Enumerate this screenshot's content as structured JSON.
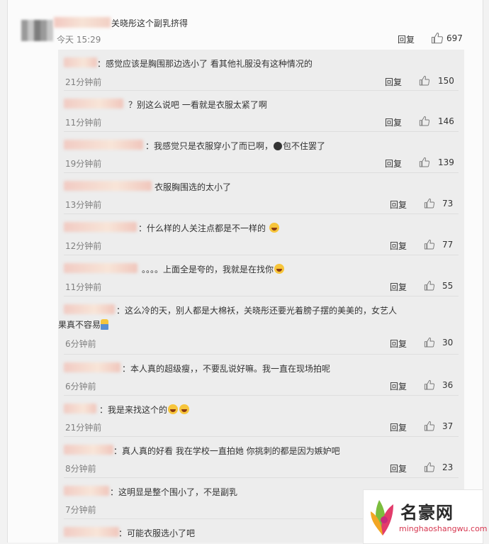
{
  "main_comment": {
    "text": "关晓彤这个副乳挤得",
    "time": "今天 15:29",
    "reply_label": "回复",
    "likes": "697"
  },
  "replies": [
    {
      "text": "：感觉应该是胸围那边选小了  看其他礼服没有这种情况的",
      "time": "21分钟前",
      "reply_label": "回复",
      "likes": "150"
    },
    {
      "text": "？别这么说吧 一看就是衣服太紧了啊",
      "time": "11分钟前",
      "reply_label": "回复",
      "likes": "146"
    },
    {
      "text_before": "：我感觉只是衣服穿小了而已啊，",
      "text_after": "包不住罢了",
      "time": "19分钟前",
      "reply_label": "回复",
      "likes": "139"
    },
    {
      "text": "衣服胸围选的太小了",
      "time": "13分钟前",
      "reply_label": "回复",
      "likes": "73"
    },
    {
      "text": "：什么样的人关注点都是不一样的",
      "time": "12分钟前",
      "reply_label": "回复",
      "likes": "77"
    },
    {
      "text": "。。。。上面全是夸的，我就是在找你",
      "time": "11分钟前",
      "reply_label": "回复",
      "likes": "55"
    },
    {
      "text": "：这么冷的天，别人都是大棉袄，关晓彤还要光着膀子摆的美美的，女艺人果真不容易",
      "time": "6分钟前",
      "reply_label": "回复",
      "likes": "30"
    },
    {
      "text": "：本人真的超级瘦，，不要乱说好嘛。我一直在现场拍呢",
      "time": "6分钟前",
      "reply_label": "回复",
      "likes": "36"
    },
    {
      "text": "：我是来找这个的",
      "time": "21分钟前",
      "reply_label": "回复",
      "likes": "37"
    },
    {
      "text": "：真人真的好看 我在学校一直拍她 你挑刺的都是因为嫉妒吧",
      "time": "8分钟前",
      "reply_label": "回复",
      "likes": "23"
    },
    {
      "text": "：这明显是整个围小了，不是副乳",
      "time": "7分钟前"
    },
    {
      "text": "：可能衣服选小了吧"
    }
  ],
  "watermark": {
    "title": "名豪网",
    "url": "minghaoshangwu.com"
  },
  "icons": {
    "like": "thumbs-up-icon",
    "emoji_bear": "bear-emoji-icon",
    "emoji_tears": "laugh-tears-emoji-icon",
    "emoji_laugh": "laughing-emoji-icon",
    "emoji_fig": "figure-emoji-icon"
  },
  "colors": {
    "time": "#808080",
    "reply_bg": "#ededed",
    "watermark_url": "#d6364f"
  }
}
